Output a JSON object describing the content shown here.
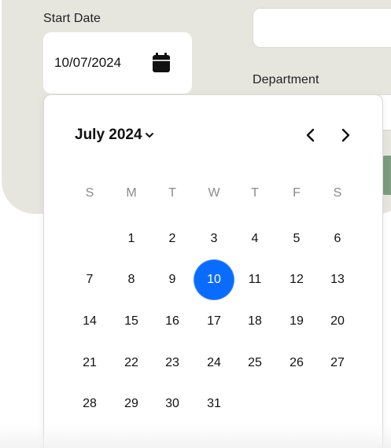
{
  "form": {
    "start_date_label": "Start Date",
    "start_date_value": "10/07/2024",
    "department_label": "Department",
    "top_field_value": "",
    "department_value": ""
  },
  "calendar": {
    "month_label": "July 2024",
    "month_dropdown_icon": "chevron-down-icon",
    "prev_icon": "chevron-left-icon",
    "next_icon": "chevron-right-icon",
    "weekdays": [
      "S",
      "M",
      "T",
      "W",
      "T",
      "F",
      "S"
    ],
    "weeks": [
      [
        "",
        "1",
        "2",
        "3",
        "4",
        "5",
        "6"
      ],
      [
        "7",
        "8",
        "9",
        "10",
        "11",
        "12",
        "13"
      ],
      [
        "14",
        "15",
        "16",
        "17",
        "18",
        "19",
        "20"
      ],
      [
        "21",
        "22",
        "23",
        "24",
        "25",
        "26",
        "27"
      ],
      [
        "28",
        "29",
        "30",
        "31",
        "",
        "",
        ""
      ]
    ],
    "selected_day": "10"
  },
  "colors": {
    "selected_day_bg": "#0a6cff",
    "form_bg": "#e6e6df",
    "accent_green": "#7d9c80"
  },
  "icons": {
    "date_field_icon": "calendar-icon"
  }
}
